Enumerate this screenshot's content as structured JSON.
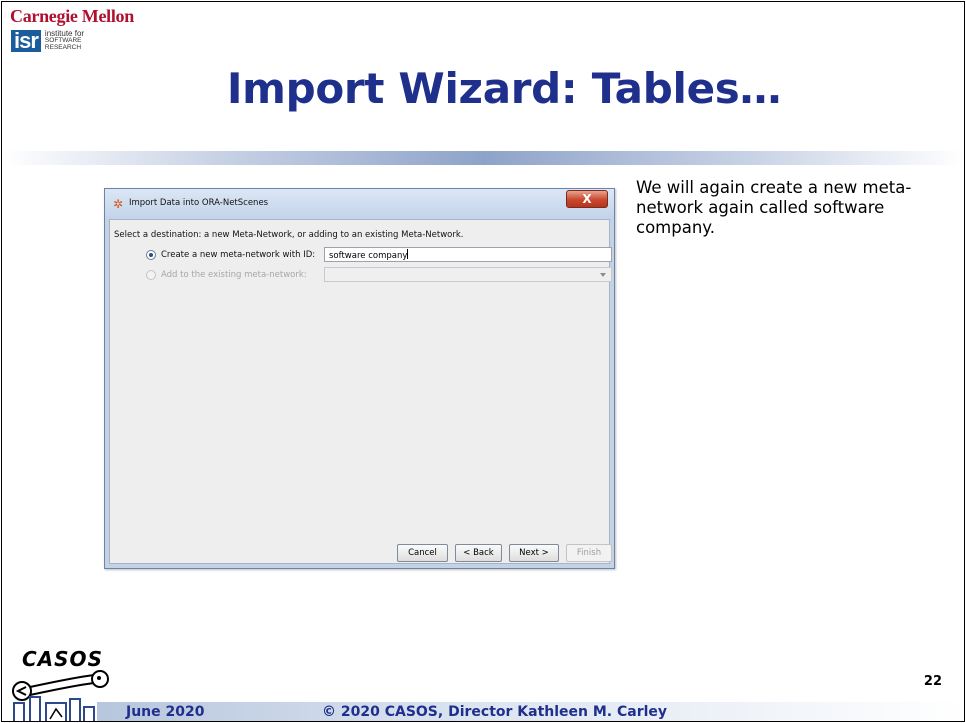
{
  "slide": {
    "institution": "Carnegie Mellon",
    "institute_mark": "isr",
    "institute_text": [
      "institute for",
      "SOFTWARE",
      "RESEARCH"
    ],
    "title": "Import Wizard: Tables…",
    "side_text": "We will again create a new meta-network again called software company.",
    "footer": {
      "date": "June 2020",
      "copyright": "© 2020 CASOS, Director Kathleen M. Carley",
      "page_number": "22",
      "logo_text": "CASOS"
    }
  },
  "dialog": {
    "title": "Import Data into ORA-NetScenes",
    "close_label": "X",
    "prompt": "Select a destination: a new Meta-Network, or adding to an existing Meta-Network.",
    "option_new_label": "Create a new meta-network with ID:",
    "option_new_selected": true,
    "id_value": "software company",
    "option_existing_label": "Add to the existing meta-network:",
    "option_existing_enabled": false,
    "existing_value": "",
    "buttons": {
      "cancel": "Cancel",
      "back": "< Back",
      "next": "Next >",
      "finish": "Finish"
    }
  },
  "colors": {
    "title": "#1f2f8c",
    "cmu_red": "#b0102f",
    "window_frame": "#c4d2e6",
    "close_button": "#c7482f"
  },
  "icons": {
    "app_icon": "ora-network-icon",
    "close": "close-icon",
    "dropdown": "chevron-down-icon"
  }
}
